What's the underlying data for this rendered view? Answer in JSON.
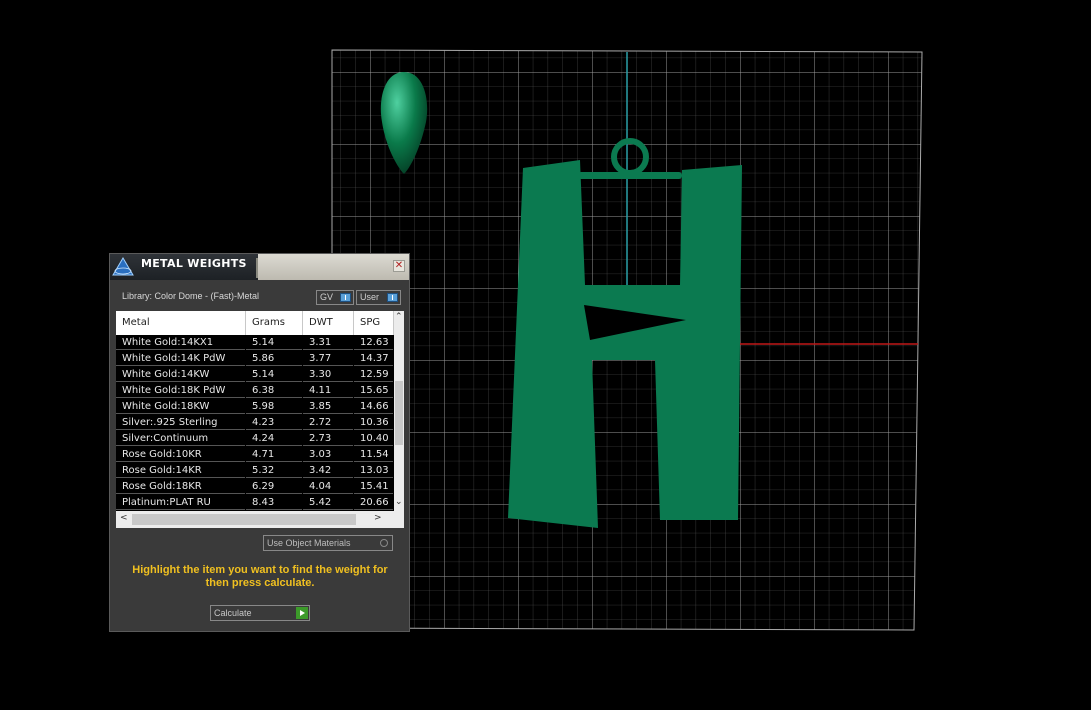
{
  "dialog": {
    "title": "METAL WEIGHTS",
    "close_label": "✕",
    "library_label": "Library: Color Dome - (Fast)-Metal",
    "toggle_gv": "GV",
    "toggle_user": "User",
    "columns": [
      "Metal",
      "Grams",
      "DWT",
      "SPG"
    ],
    "rows": [
      [
        "White Gold:14KX1",
        "5.14",
        "3.31",
        "12.63"
      ],
      [
        "White Gold:14K PdW",
        "5.86",
        "3.77",
        "14.37"
      ],
      [
        "White Gold:14KW",
        "5.14",
        "3.30",
        "12.59"
      ],
      [
        "White Gold:18K PdW",
        "6.38",
        "4.11",
        "15.65"
      ],
      [
        "White Gold:18KW",
        "5.98",
        "3.85",
        "14.66"
      ],
      [
        "Silver:.925 Sterling",
        "4.23",
        "2.72",
        "10.36"
      ],
      [
        "Silver:Continuum",
        "4.24",
        "2.73",
        "10.40"
      ],
      [
        "Rose Gold:10KR",
        "4.71",
        "3.03",
        "11.54"
      ],
      [
        "Rose Gold:14KR",
        "5.32",
        "3.42",
        "13.03"
      ],
      [
        "Rose Gold:18KR",
        "6.29",
        "4.04",
        "15.41"
      ],
      [
        "Platinum:PLAT RU",
        "8.43",
        "5.42",
        "20.66"
      ]
    ],
    "use_object_materials": "Use Object Materials",
    "hint": "Highlight the item you want to find the weight for then press calculate.",
    "calculate_label": "Calculate"
  },
  "scene": {
    "model_color": "#0b7a50",
    "grid_color": "#8a8a8a",
    "axis_y_color": "#2aa0a8",
    "axis_x_color": "#c01818"
  }
}
